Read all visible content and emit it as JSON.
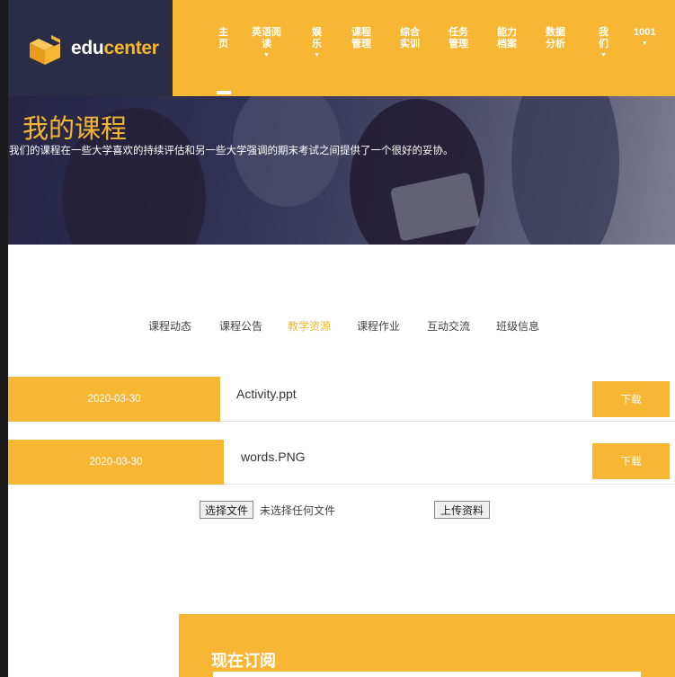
{
  "logo": {
    "text_main": "edu",
    "text_accent": "center"
  },
  "nav": {
    "items": [
      {
        "label": "主\n页",
        "caret": ""
      },
      {
        "label": "英语阅\n读",
        "caret": "▼"
      },
      {
        "label": "娱\n乐",
        "caret": "▼"
      },
      {
        "label": "课程\n管理",
        "caret": ""
      },
      {
        "label": "综合\n实训",
        "caret": ""
      },
      {
        "label": "任务\n管理",
        "caret": ""
      },
      {
        "label": "能力\n档案",
        "caret": ""
      },
      {
        "label": "数据\n分析",
        "caret": ""
      },
      {
        "label": "我\n们",
        "caret": "▼"
      },
      {
        "label": "1001",
        "caret": "▼"
      }
    ]
  },
  "hero": {
    "title": "我的课程",
    "subtitle": "我们的课程在一些大学喜欢的持续评估和另一些大学强调的期末考试之间提供了一个很好的妥协。"
  },
  "tabs": [
    {
      "label": "课程动态",
      "active": false
    },
    {
      "label": "课程公告",
      "active": false
    },
    {
      "label": "教学资源",
      "active": true
    },
    {
      "label": "课程作业",
      "active": false
    },
    {
      "label": "互动交流",
      "active": false
    },
    {
      "label": "班级信息",
      "active": false
    }
  ],
  "resources": [
    {
      "date": "2020-03-30",
      "filename": "Activity.ppt",
      "download_label": "下载"
    },
    {
      "date": "2020-03-30",
      "filename": "words.PNG",
      "download_label": "下载"
    }
  ],
  "upload": {
    "choose_file_label": "选择文件",
    "file_status": "未选择任何文件",
    "upload_label": "上传资料"
  },
  "subscribe": {
    "title": "现在订阅"
  },
  "colors": {
    "accent": "#f7b634",
    "dark": "#2b2c46"
  }
}
